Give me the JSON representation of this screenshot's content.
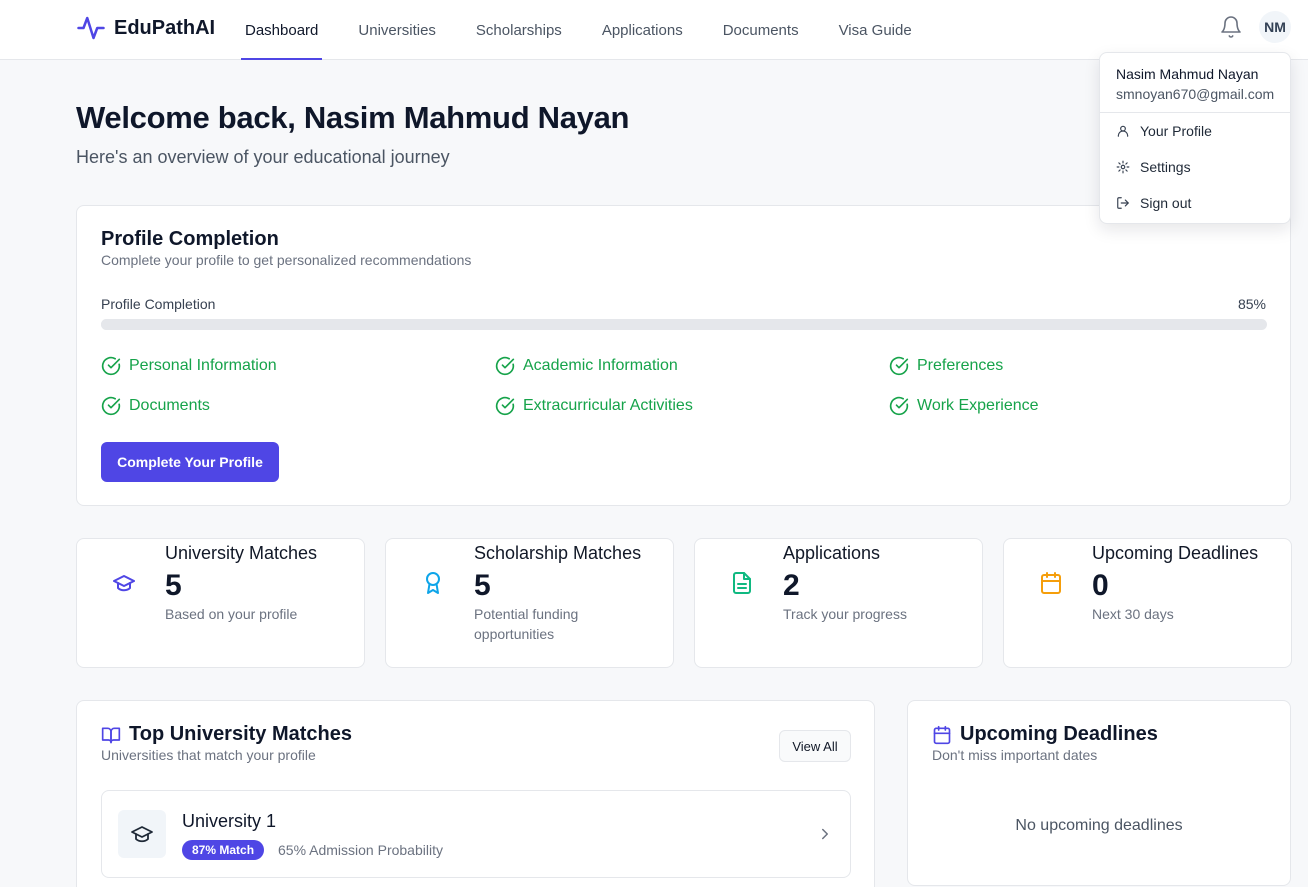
{
  "brand": {
    "name": "EduPathAI",
    "accent": "#4f46e5"
  },
  "nav": {
    "items": [
      {
        "label": "Dashboard",
        "active": true
      },
      {
        "label": "Universities",
        "active": false
      },
      {
        "label": "Scholarships",
        "active": false
      },
      {
        "label": "Applications",
        "active": false
      },
      {
        "label": "Documents",
        "active": false
      },
      {
        "label": "Visa Guide",
        "active": false
      }
    ],
    "bell_icon": "bell-icon",
    "avatar_initials": "NM"
  },
  "user_menu": {
    "name": "Nasim Mahmud Nayan",
    "email": "smnoyan670@gmail.com",
    "items": [
      {
        "label": "Your Profile",
        "icon": "user-icon"
      },
      {
        "label": "Settings",
        "icon": "gear-icon"
      },
      {
        "label": "Sign out",
        "icon": "sign-out-icon"
      }
    ]
  },
  "welcome": {
    "title": "Welcome back, Nasim Mahmud Nayan",
    "subtitle": "Here's an overview of your educational journey"
  },
  "profile_completion": {
    "title": "Profile Completion",
    "subtitle": "Complete your profile to get personalized recommendations",
    "bar_label": "Profile Completion",
    "percent_text": "85%",
    "percent_value": 85,
    "items": [
      {
        "label": "Personal Information",
        "done": true
      },
      {
        "label": "Academic Information",
        "done": true
      },
      {
        "label": "Preferences",
        "done": true
      },
      {
        "label": "Documents",
        "done": true
      },
      {
        "label": "Extracurricular Activities",
        "done": true
      },
      {
        "label": "Work Experience",
        "done": true
      }
    ],
    "button_label": "Complete Your Profile",
    "complete_color": "#16a34a"
  },
  "stats": [
    {
      "label": "University Matches",
      "value": "5",
      "desc": "Based on your profile",
      "icon": "graduation-cap-icon",
      "color": "#4f46e5"
    },
    {
      "label": "Scholarship Matches",
      "value": "5",
      "desc": "Potential funding opportunities",
      "icon": "award-icon",
      "color": "#0ea5e9"
    },
    {
      "label": "Applications",
      "value": "2",
      "desc": "Track your progress",
      "icon": "file-text-icon",
      "color": "#10b981"
    },
    {
      "label": "Upcoming Deadlines",
      "value": "0",
      "desc": "Next 30 days",
      "icon": "calendar-icon",
      "color": "#f59e0b"
    }
  ],
  "top_matches": {
    "title": "Top University Matches",
    "subtitle": "Universities that match your profile",
    "view_all_label": "View All",
    "universities": [
      {
        "name": "University 1",
        "match": "87% Match",
        "probability": "65% Admission Probability"
      }
    ]
  },
  "deadlines": {
    "title": "Upcoming Deadlines",
    "subtitle": "Don't miss important dates",
    "empty_text": "No upcoming deadlines"
  }
}
